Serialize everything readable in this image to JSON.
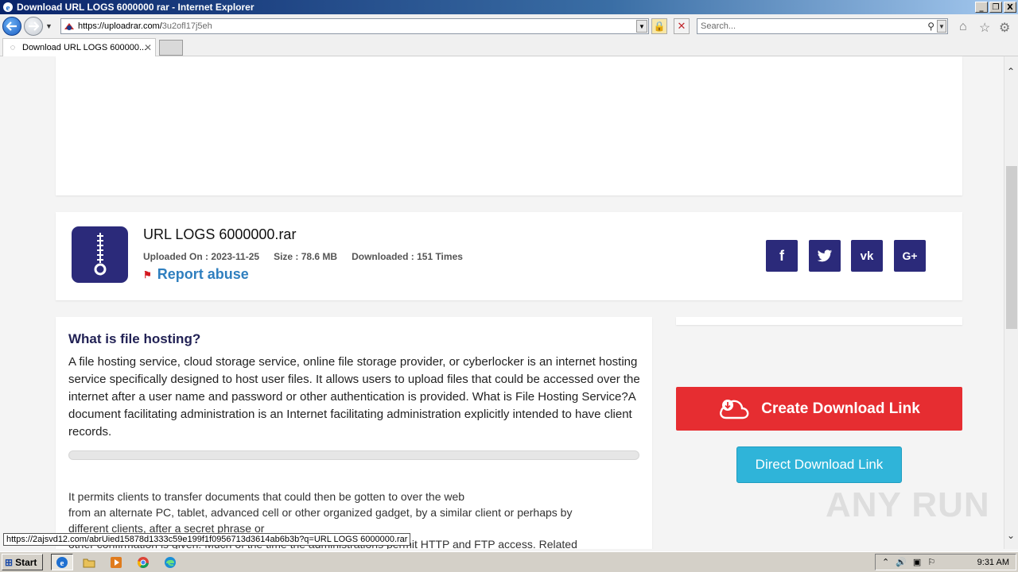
{
  "window": {
    "title": "Download URL LOGS 6000000 rar - Internet Explorer",
    "min_label": "_",
    "restore_label": "❐",
    "close_label": "X"
  },
  "browser": {
    "url_host": "https://uploadrar.com/",
    "url_path": "3u2ofl17j5eh",
    "search_placeholder": "Search...",
    "tab_title": "Download URL LOGS 600000...",
    "status_url": "https://2ajsvd12.com/abrUied15878d1333c59e199f1f0956713d3614ab6b3b?q=URL LOGS 6000000.rar"
  },
  "file": {
    "name": "URL LOGS 6000000.rar",
    "uploaded_on": "Uploaded On : 2023-11-25",
    "size": "Size : 78.6 MB",
    "downloaded": "Downloaded : 151 Times",
    "report_label": "Report abuse"
  },
  "social": {
    "facebook": "f",
    "twitter": "🐦",
    "vk": "vk",
    "gplus": "G+"
  },
  "article": {
    "heading": "What is file hosting?",
    "paragraph1": "A file hosting service, cloud storage service, online file storage provider, or cyberlocker is an internet hosting service specifically designed to host user files. It allows users to upload files that could be accessed over the internet after a user name and password or other authentication is provided. What is File Hosting Service?A document facilitating administration is an Internet facilitating administration explicitly intended to have client records.",
    "paragraph2_line1": "It permits clients to transfer documents that could then be gotten to over the web",
    "paragraph2_line2": "from an alternate PC, tablet, advanced cell or other organized gadget, by a similar client or perhaps by",
    "paragraph2_line3": "different clients, after a secret phrase or",
    "paragraph2_line4": "other confirmation is given. Much of the time the administrations permit HTTP and FTP access. Related"
  },
  "actions": {
    "create_link": "Create Download Link",
    "direct_link": "Direct Download Link"
  },
  "watermark": "ANY RUN",
  "taskbar": {
    "start_label": "Start",
    "clock": "9:31 AM"
  },
  "colors": {
    "brand_dark": "#2b2a7a",
    "create_red": "#e62d31",
    "direct_blue": "#2fb4d9",
    "link_blue": "#2f7fbf"
  }
}
